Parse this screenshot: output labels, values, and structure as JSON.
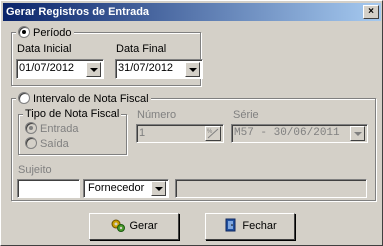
{
  "window": {
    "title": "Gerar Registros de Entrada",
    "close_glyph": "×"
  },
  "periodo": {
    "label": "Período",
    "selected": true,
    "data_inicial": {
      "label": "Data Inicial",
      "value": "01/07/2012"
    },
    "data_final": {
      "label": "Data Final",
      "value": "31/07/2012"
    }
  },
  "intervalo": {
    "label": "Intervalo de Nota Fiscal",
    "selected": false,
    "tipo_nota": {
      "label": "Tipo de Nota Fiscal",
      "options": [
        "Entrada",
        "Saída"
      ],
      "selected": "Entrada"
    },
    "numero": {
      "label": "Número",
      "value": "1"
    },
    "serie": {
      "label": "Série",
      "value": "M57 - 30/06/2011"
    },
    "sujeito": {
      "label": "Sujeito",
      "value": "",
      "type_value": "Fornecedor",
      "name_value": ""
    }
  },
  "buttons": {
    "gerar": "Gerar",
    "fechar": "Fechar"
  }
}
